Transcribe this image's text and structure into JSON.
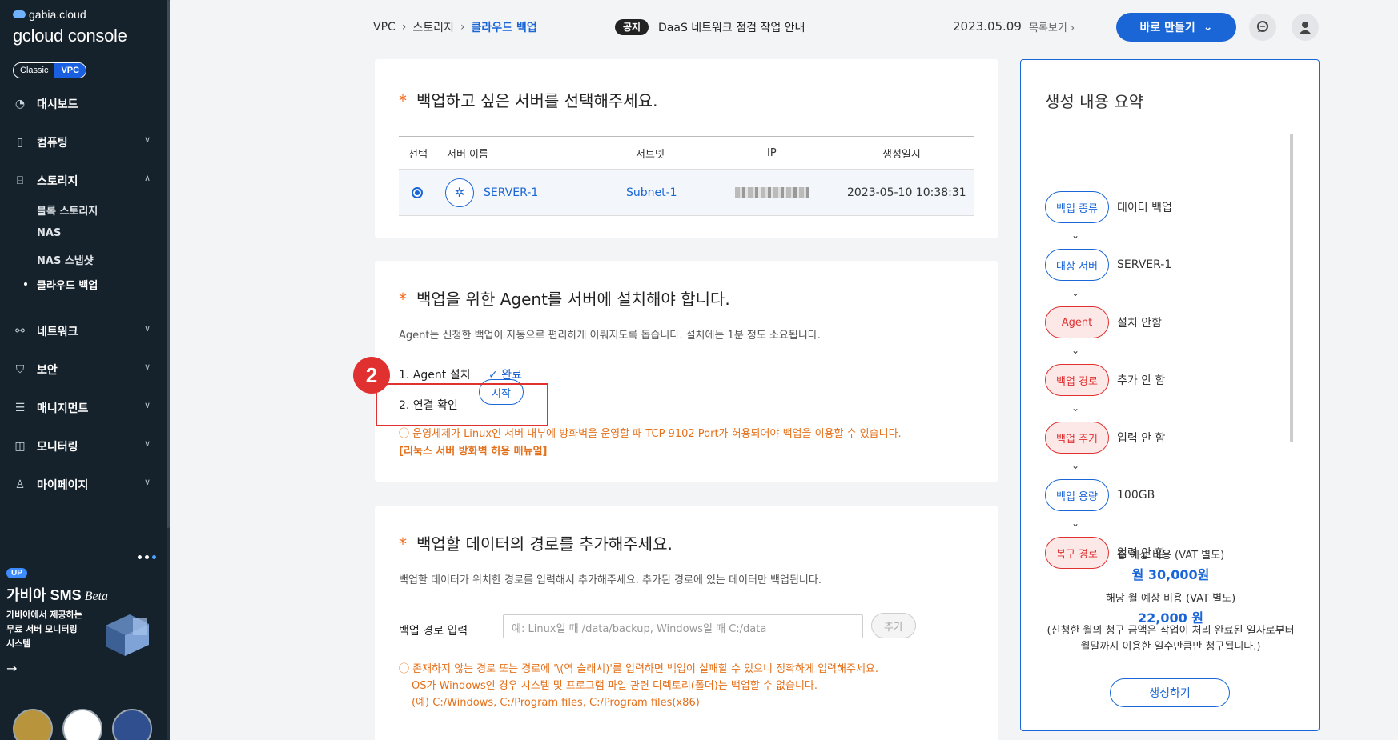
{
  "sidebar": {
    "brand_top": "gabia.cloud",
    "brand_main": "gcloud console",
    "mode": {
      "classic": "Classic",
      "vpc": "VPC"
    },
    "items": [
      {
        "label": "대시보드",
        "icon": "gauge-icon"
      },
      {
        "label": "컴퓨팅",
        "icon": "chip-icon"
      },
      {
        "label": "스토리지",
        "icon": "drive-icon"
      },
      {
        "label": "네트워크",
        "icon": "network-icon"
      },
      {
        "label": "보안",
        "icon": "shield-icon"
      },
      {
        "label": "매니지먼트",
        "icon": "server-stack-icon"
      },
      {
        "label": "모니터링",
        "icon": "monitor-chart-icon"
      },
      {
        "label": "마이페이지",
        "icon": "person-icon"
      }
    ],
    "storage_sub": [
      "블록 스토리지",
      "NAS",
      "NAS 스냅샷",
      "클라우드 백업"
    ],
    "promo": {
      "badge": "UP",
      "title": "가비아 SMS",
      "title_suffix": "Beta",
      "desc_lines": [
        "가비아에서 제공하는",
        "무료 서버 모니터링",
        "시스템"
      ]
    }
  },
  "header": {
    "breadcrumb": [
      "VPC",
      "스토리지",
      "클라우드 백업"
    ],
    "notice_tag": "공지",
    "notice_text": "DaaS 네트워크 점검 작업 안내",
    "notice_date": "2023.05.09",
    "notice_more": "목록보기",
    "make_label": "바로 만들기"
  },
  "server_card": {
    "title": "백업하고 싶은 서버를 선택해주세요.",
    "columns": [
      "선택",
      "서버 이름",
      "서브넷",
      "IP",
      "생성일시"
    ],
    "row": {
      "name": "SERVER-1",
      "subnet": "Subnet-1",
      "created": "2023-05-10 10:38:31"
    }
  },
  "agent_card": {
    "title": "백업을 위한 Agent를 서버에 설치해야 합니다.",
    "desc": "Agent는 신청한 백업이 자동으로 편리하게 이뤄지도록 돕습니다. 설치에는 1분 정도 소요됩니다.",
    "step1": "1. Agent 설치",
    "step1_status": "완료",
    "step2": "2. 연결 확인",
    "start_label": "시작",
    "warning": "ⓘ 운영체제가 Linux인 서버 내부에 방화벽을 운영할 때 TCP 9102 Port가 허용되어야 백업을 이용할 수 있습니다.",
    "manual_link": "[리눅스 서버 방화벽 허용 매뉴얼]",
    "marker": "2"
  },
  "path_card": {
    "title": "백업할 데이터의 경로를 추가해주세요.",
    "desc": "백업할 데이터가 위치한 경로를 입력해서 추가해주세요. 추가된 경로에 있는 데이터만 백업됩니다.",
    "input_label": "백업 경로 입력",
    "placeholder": "예: Linux일 때 /data/backup, Windows일 때 C:/data",
    "add_label": "추가",
    "warn1": "ⓘ 존재하지 않는 경로 또는 경로에 '\\(역 슬래시)'를 입력하면 백업이 실패할 수 있으니 정확하게 입력해주세요.",
    "warn2": "OS가 Windows인 경우 시스템 및 프로그램 파일 관련 디렉토리(폴더)는 백업할 수 없습니다.",
    "warn3": "(예) C:/Windows, C:/Program files, C:/Program files(x86)"
  },
  "summary": {
    "title": "생성 내용 요약",
    "items": [
      {
        "key": "백업 종류",
        "value": "데이터 백업",
        "state": "ok"
      },
      {
        "key": "대상 서버",
        "value": "SERVER-1",
        "state": "ok"
      },
      {
        "key": "Agent",
        "value": "설치 안함",
        "state": "no"
      },
      {
        "key": "백업 경로",
        "value": "추가 안 함",
        "state": "no"
      },
      {
        "key": "백업 주기",
        "value": "입력 안 함",
        "state": "no"
      },
      {
        "key": "백업 용량",
        "value": "100GB",
        "state": "ok"
      },
      {
        "key": "복구 경로",
        "value": "입력 안 함",
        "state": "no"
      }
    ],
    "total_label": "총 예상 비용 (VAT 별도)",
    "total_value": "월 30,000원",
    "month_label": "해당 월 예상 비용 (VAT 별도)",
    "month_value": "22,000 원",
    "note1": "(신청한 월의 청구 금액은 작업이 처리 완료된 일자로부터",
    "note2": "월말까지 이용한 일수만큼만 청구됩니다.)",
    "create_label": "생성하기"
  }
}
